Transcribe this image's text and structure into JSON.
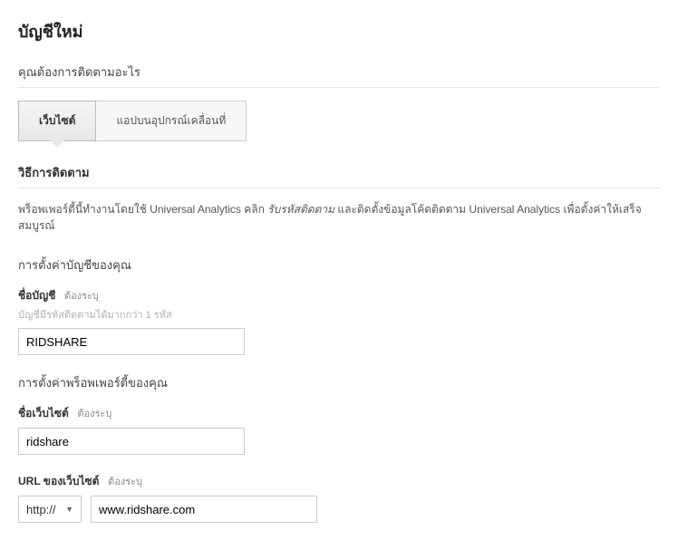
{
  "page": {
    "title": "บัญชีใหม่"
  },
  "track_prompt": "คุณต้องการติดตามอะไร",
  "tabs": {
    "website": "เว็บไซต์",
    "mobile": "แอปบนอุปกรณ์เคลื่อนที่"
  },
  "method": {
    "heading": "วิธีการติดตาม",
    "desc_before": "พร็อพเพอร์ตี้นี้ทำงานโดยใช้ Universal Analytics คลิก",
    "desc_emph": "รับรหัสติดตาม",
    "desc_after": "และติดตั้งข้อมูลโค้ดติดตาม Universal Analytics เพื่อตั้งค่าให้เสร็จสมบูรณ์"
  },
  "account_setup": {
    "heading": "การตั้งค่าบัญชีของคุณ",
    "name_label": "ชื่อบัญชี",
    "required": "ต้องระบุ",
    "hint": "บัญชีมีรหัสติดตามได้มากกว่า 1 รหัส",
    "name_value": "RIDSHARE"
  },
  "property_setup": {
    "heading": "การตั้งค่าพร็อพเพอร์ตี้ของคุณ",
    "site_name_label": "ชื่อเว็บไซต์",
    "required": "ต้องระบุ",
    "site_name_value": "ridshare",
    "url_label": "URL ของเว็บไซต์",
    "url_required": "ต้องระบุ",
    "protocol": "http://",
    "url_value": "www.ridshare.com"
  }
}
